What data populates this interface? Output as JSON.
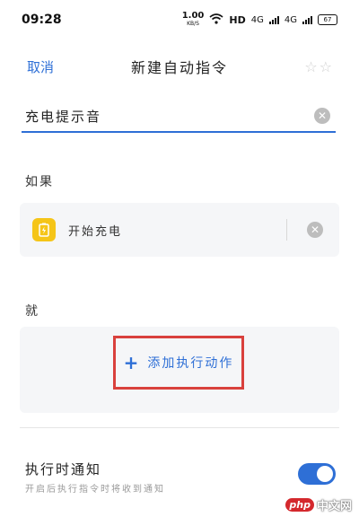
{
  "status": {
    "time": "09:28",
    "speed_value": "1.00",
    "speed_unit": "KB/S",
    "hd": "HD",
    "net_a": "4G",
    "net_b": "4G",
    "battery": "67"
  },
  "nav": {
    "cancel": "取消",
    "title": "新建自动指令",
    "star": "☆☆"
  },
  "name_field": {
    "value": "充电提示音"
  },
  "if_section": {
    "label": "如果",
    "condition": "开始充电"
  },
  "then_section": {
    "label": "就",
    "add_action": "添加执行动作"
  },
  "notify": {
    "title": "执行时通知",
    "subtitle": "开启后执行指令时将收到通知",
    "enabled": true
  },
  "watermark": {
    "logo": "php",
    "text": "中文网"
  },
  "colors": {
    "accent": "#2e6fd6",
    "highlight": "#d9413d",
    "charge_icon": "#f5c518"
  }
}
